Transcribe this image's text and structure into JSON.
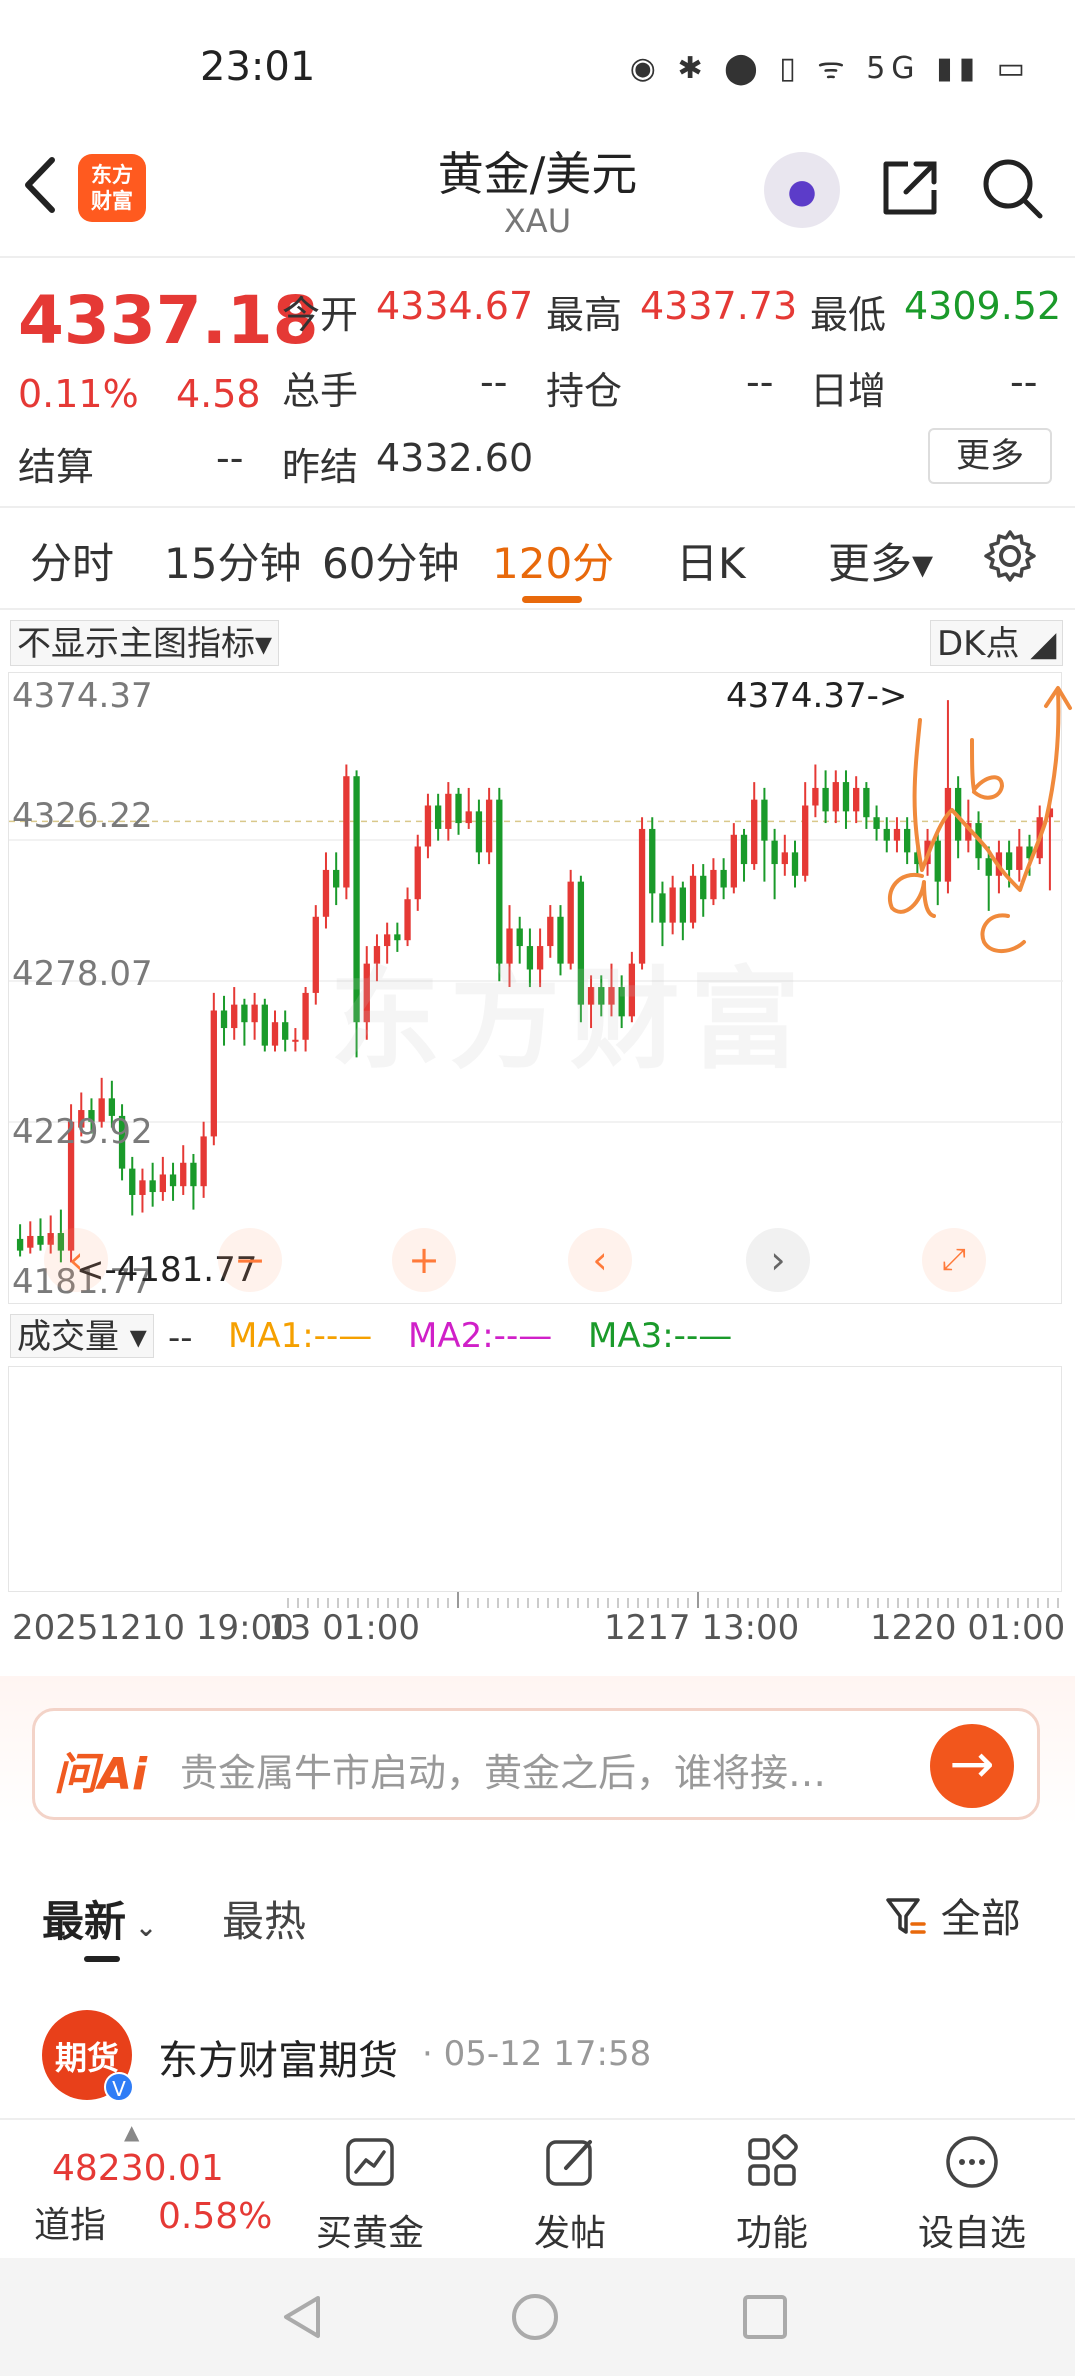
{
  "status_bar": {
    "time": "23:01",
    "icons": "◉ ✱ ⬤ ▯ ᯤ 5G ▮▮ ▭"
  },
  "header": {
    "logo_text": "东方\n财富",
    "title": "黄金/美元",
    "subtitle": "XAU"
  },
  "quote": {
    "price": "4337.18",
    "change_pct": "0.11%",
    "change": "4.58",
    "open_label": "今开",
    "open": "4334.67",
    "high_label": "最高",
    "high": "4337.73",
    "low_label": "最低",
    "low": "4309.52",
    "volume_label": "总手",
    "volume": "--",
    "position_label": "持仓",
    "position": "--",
    "daily_inc_label": "日增",
    "daily_inc": "--",
    "settle_label": "结算",
    "settle": "--",
    "prev_settle_label": "昨结",
    "prev_settle": "4332.60",
    "more_label": "更多"
  },
  "tabs": {
    "fenshi": "分时",
    "m15": "15分钟",
    "m60": "60分钟",
    "m120": "120分",
    "dayk": "日K",
    "more": "更多▾"
  },
  "chart_controls": {
    "main_indicator": "不显示主图指标▾",
    "dk_button": "DK点",
    "volume_indicator": "成交量 ▾",
    "volume_dash": "--",
    "ma1": "MA1:--—",
    "ma2": "MA2:--—",
    "ma3": "MA3:--—"
  },
  "chart_data": {
    "type": "candlestick",
    "y_ticks": [
      "4374.37",
      "4326.22",
      "4278.07",
      "4229.92",
      "4181.77"
    ],
    "ylim": [
      4181.77,
      4374.37
    ],
    "high_marker": "4374.37->",
    "low_marker": "<-4181.77",
    "x_ticks": [
      "20251210 19:00",
      "13 01:00",
      "1217 13:00",
      "1220 01:00"
    ],
    "reference_line": 4332.6,
    "candles": [
      [
        4190,
        4186,
        4195,
        4184
      ],
      [
        4187,
        4191,
        4196,
        4185
      ],
      [
        4191,
        4188,
        4197,
        4186
      ],
      [
        4188,
        4192,
        4198,
        4185
      ],
      [
        4192,
        4186,
        4200,
        4182
      ],
      [
        4186,
        4230,
        4236,
        4182
      ],
      [
        4228,
        4234,
        4240,
        4225
      ],
      [
        4234,
        4230,
        4238,
        4226
      ],
      [
        4230,
        4238,
        4245,
        4228
      ],
      [
        4238,
        4232,
        4244,
        4228
      ],
      [
        4232,
        4214,
        4236,
        4210
      ],
      [
        4214,
        4205,
        4218,
        4198
      ],
      [
        4205,
        4210,
        4214,
        4199
      ],
      [
        4210,
        4206,
        4216,
        4201
      ],
      [
        4206,
        4212,
        4218,
        4203
      ],
      [
        4212,
        4208,
        4216,
        4203
      ],
      [
        4208,
        4216,
        4222,
        4205
      ],
      [
        4216,
        4208,
        4219,
        4200
      ],
      [
        4208,
        4225,
        4230,
        4204
      ],
      [
        4225,
        4268,
        4274,
        4222
      ],
      [
        4268,
        4262,
        4273,
        4256
      ],
      [
        4262,
        4270,
        4276,
        4258
      ],
      [
        4270,
        4264,
        4272,
        4256
      ],
      [
        4264,
        4270,
        4274,
        4258
      ],
      [
        4270,
        4256,
        4272,
        4254
      ],
      [
        4256,
        4264,
        4268,
        4254
      ],
      [
        4264,
        4258,
        4268,
        4254
      ],
      [
        4258,
        4258,
        4262,
        4254
      ],
      [
        4258,
        4274,
        4276,
        4254
      ],
      [
        4274,
        4300,
        4304,
        4270
      ],
      [
        4300,
        4316,
        4322,
        4296
      ],
      [
        4316,
        4310,
        4322,
        4304
      ],
      [
        4310,
        4348,
        4352,
        4306
      ],
      [
        4348,
        4264,
        4350,
        4252
      ],
      [
        4264,
        4284,
        4290,
        4258
      ],
      [
        4284,
        4290,
        4294,
        4278
      ],
      [
        4290,
        4294,
        4298,
        4284
      ],
      [
        4294,
        4292,
        4298,
        4288
      ],
      [
        4292,
        4306,
        4310,
        4290
      ],
      [
        4306,
        4324,
        4328,
        4302
      ],
      [
        4324,
        4338,
        4342,
        4320
      ],
      [
        4338,
        4330,
        4342,
        4326
      ],
      [
        4330,
        4342,
        4346,
        4326
      ],
      [
        4342,
        4332,
        4344,
        4328
      ],
      [
        4332,
        4336,
        4344,
        4330
      ],
      [
        4336,
        4322,
        4340,
        4318
      ],
      [
        4322,
        4340,
        4344,
        4318
      ],
      [
        4340,
        4284,
        4344,
        4278
      ],
      [
        4284,
        4296,
        4304,
        4276
      ],
      [
        4296,
        4290,
        4300,
        4284
      ],
      [
        4290,
        4282,
        4296,
        4276
      ],
      [
        4282,
        4290,
        4296,
        4276
      ],
      [
        4290,
        4300,
        4304,
        4286
      ],
      [
        4300,
        4284,
        4304,
        4280
      ],
      [
        4284,
        4312,
        4316,
        4282
      ],
      [
        4312,
        4270,
        4314,
        4264
      ],
      [
        4270,
        4276,
        4280,
        4262
      ],
      [
        4276,
        4270,
        4280,
        4266
      ],
      [
        4270,
        4276,
        4284,
        4266
      ],
      [
        4276,
        4266,
        4280,
        4262
      ],
      [
        4266,
        4284,
        4288,
        4264
      ],
      [
        4284,
        4330,
        4334,
        4282
      ],
      [
        4330,
        4308,
        4334,
        4298
      ],
      [
        4308,
        4298,
        4312,
        4290
      ],
      [
        4298,
        4310,
        4314,
        4294
      ],
      [
        4310,
        4298,
        4312,
        4292
      ],
      [
        4298,
        4314,
        4318,
        4296
      ],
      [
        4314,
        4306,
        4318,
        4300
      ],
      [
        4306,
        4316,
        4320,
        4304
      ],
      [
        4316,
        4310,
        4320,
        4306
      ],
      [
        4310,
        4328,
        4332,
        4308
      ],
      [
        4328,
        4318,
        4330,
        4312
      ],
      [
        4318,
        4340,
        4346,
        4316
      ],
      [
        4340,
        4326,
        4344,
        4312
      ],
      [
        4326,
        4318,
        4330,
        4306
      ],
      [
        4318,
        4322,
        4328,
        4314
      ],
      [
        4322,
        4314,
        4326,
        4310
      ],
      [
        4314,
        4338,
        4346,
        4312
      ],
      [
        4338,
        4344,
        4352,
        4334
      ],
      [
        4344,
        4336,
        4350,
        4332
      ],
      [
        4336,
        4346,
        4350,
        4332
      ],
      [
        4346,
        4336,
        4350,
        4330
      ],
      [
        4336,
        4344,
        4348,
        4332
      ],
      [
        4344,
        4334,
        4346,
        4330
      ],
      [
        4334,
        4330,
        4338,
        4326
      ],
      [
        4330,
        4326,
        4334,
        4322
      ],
      [
        4326,
        4330,
        4334,
        4322
      ],
      [
        4330,
        4322,
        4334,
        4318
      ],
      [
        4322,
        4318,
        4326,
        4314
      ],
      [
        4318,
        4326,
        4330,
        4314
      ],
      [
        4326,
        4312,
        4330,
        4304
      ],
      [
        4312,
        4344,
        4374,
        4308
      ],
      [
        4344,
        4326,
        4348,
        4320
      ],
      [
        4326,
        4332,
        4340,
        4322
      ],
      [
        4332,
        4320,
        4336,
        4316
      ],
      [
        4320,
        4314,
        4324,
        4302
      ],
      [
        4314,
        4322,
        4326,
        4308
      ],
      [
        4322,
        4316,
        4326,
        4310
      ],
      [
        4316,
        4324,
        4330,
        4312
      ],
      [
        4324,
        4320,
        4328,
        4314
      ],
      [
        4320,
        4334,
        4338,
        4318
      ],
      [
        4334,
        4337,
        4338,
        4309
      ]
    ]
  },
  "ai_bar": {
    "logo": "问Ai",
    "placeholder": "贵金属牛市启动，黄金之后，谁将接…",
    "send": "→"
  },
  "feed": {
    "latest": "最新",
    "hot": "最热",
    "filter": "全部"
  },
  "post": {
    "avatar_text": "期货",
    "badge": "V",
    "author": "东方财富期货",
    "time": "· 05-12 17:58"
  },
  "bottom_bar": {
    "dj_value": "48230.01",
    "dj_label": "道指",
    "dj_pct": "0.58%",
    "buy_gold": "买黄金",
    "post": "发帖",
    "functions": "功能",
    "watchlist": "设自选"
  },
  "colors": {
    "up": "#e53935",
    "down": "#1a9a2a",
    "accent": "#e8690b"
  }
}
